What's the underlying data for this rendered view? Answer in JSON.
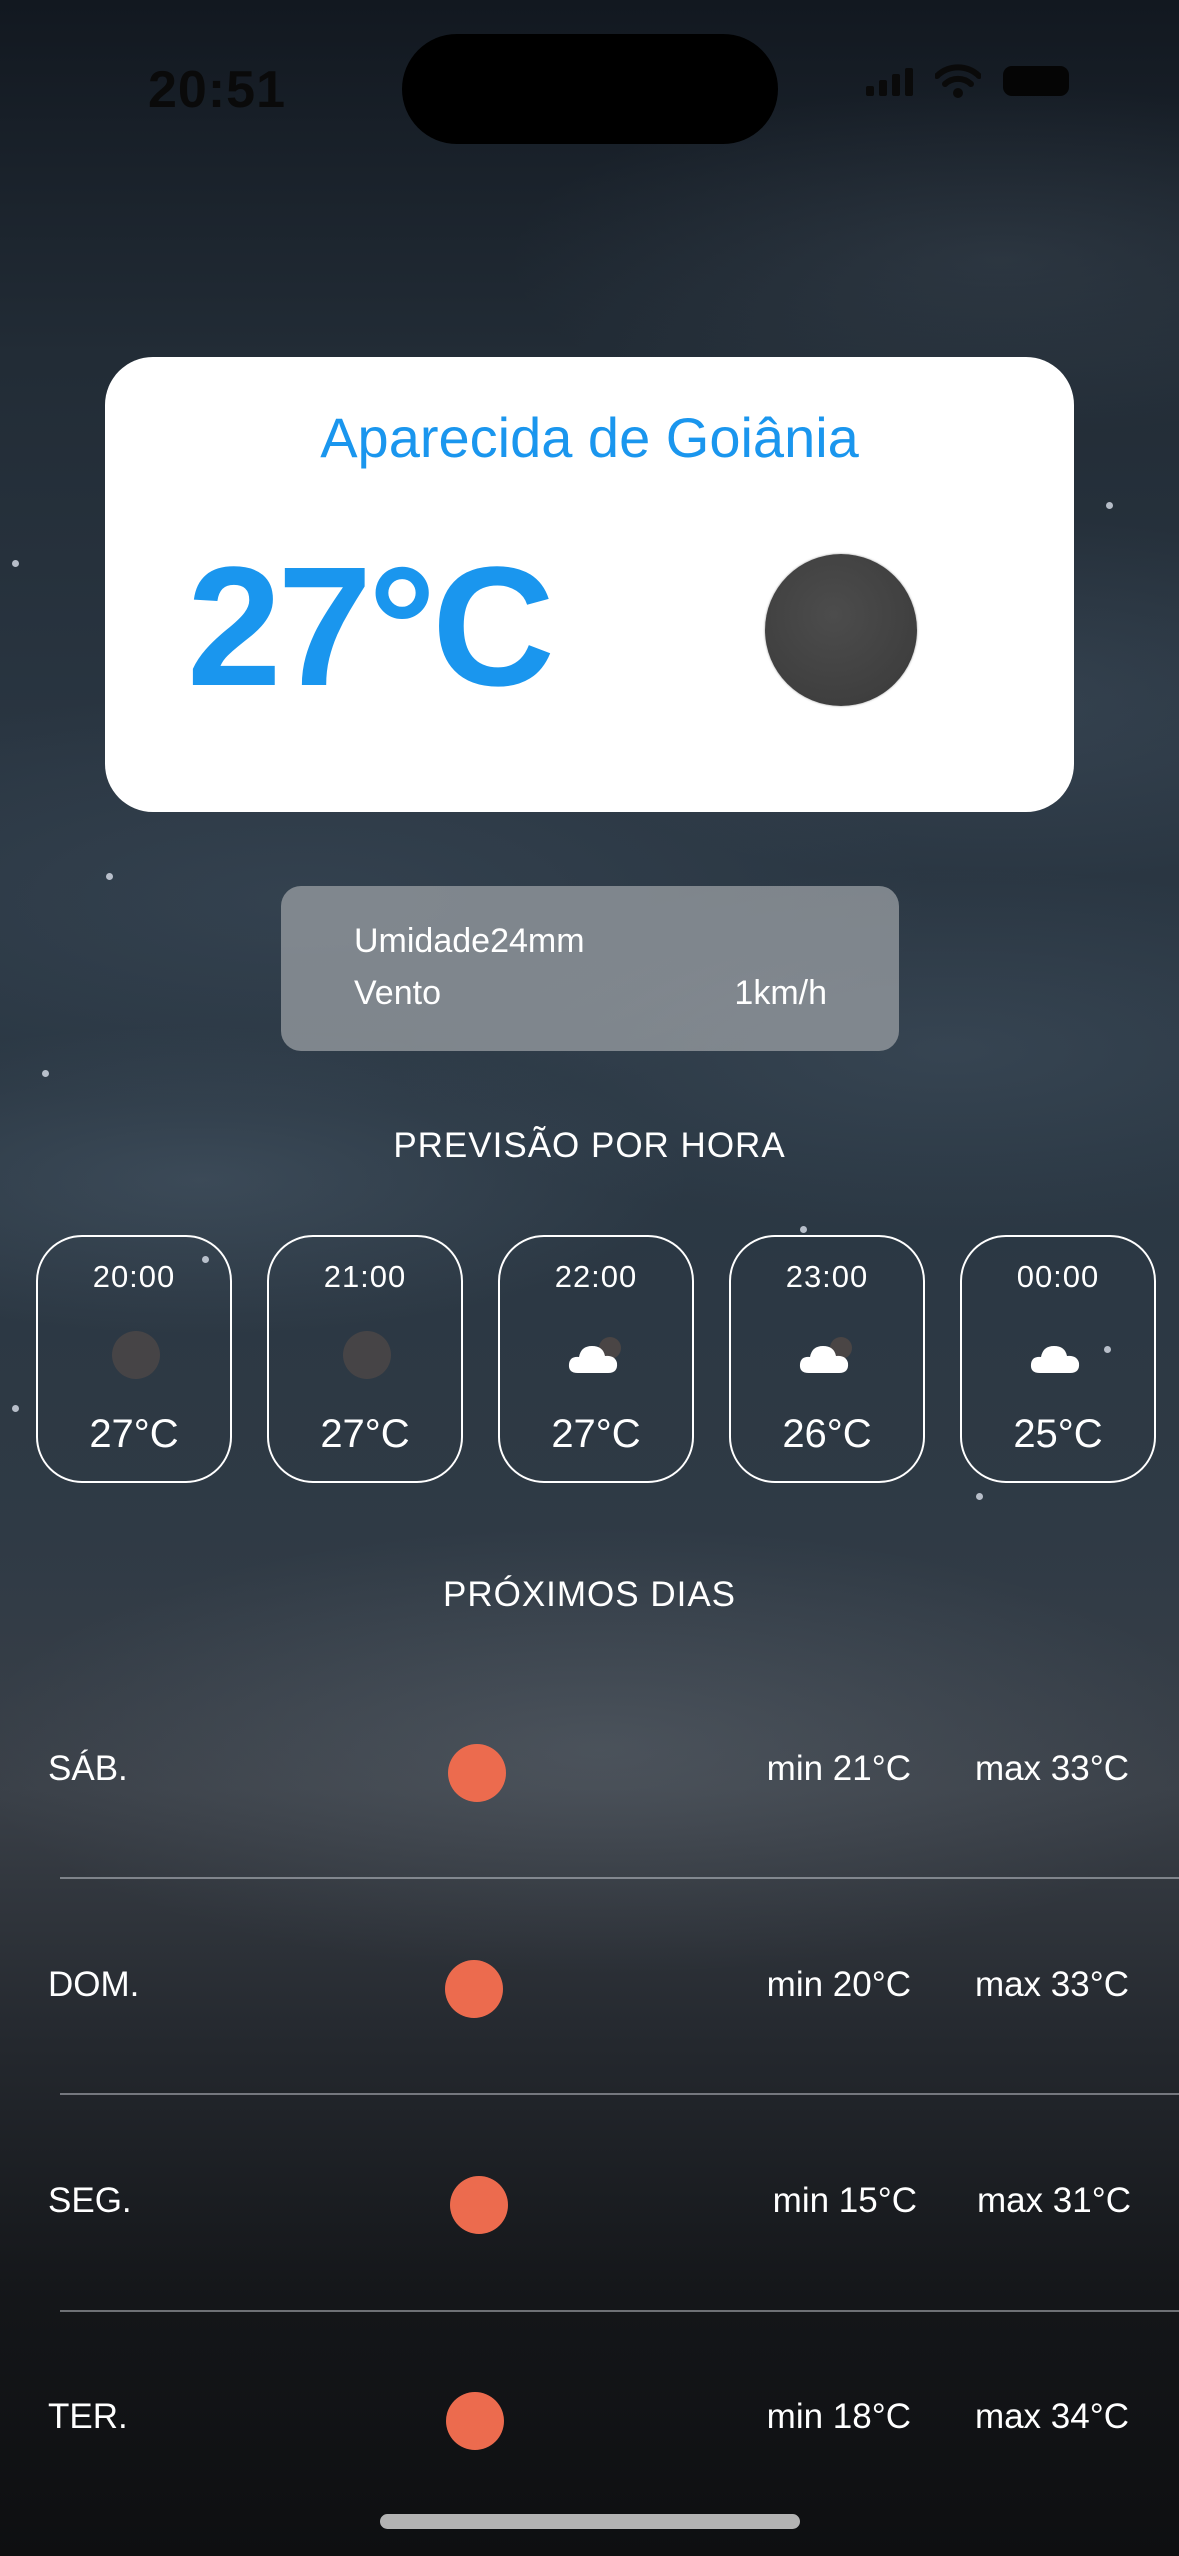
{
  "status_bar": {
    "time": "20:51"
  },
  "current": {
    "city": "Aparecida de Goiânia",
    "temperature": "27°C",
    "icon": "moon-icon"
  },
  "details": {
    "humidity_label_value": "Umidade24mm",
    "wind_label": "Vento",
    "wind_value": "1km/h"
  },
  "hourly": {
    "title": "PREVISÃO POR HORA",
    "items": [
      {
        "time": "20:00",
        "temp": "27°C",
        "icon": "moon-icon"
      },
      {
        "time": "21:00",
        "temp": "27°C",
        "icon": "moon-icon"
      },
      {
        "time": "22:00",
        "temp": "27°C",
        "icon": "cloud-moon-icon"
      },
      {
        "time": "23:00",
        "temp": "26°C",
        "icon": "cloud-moon-icon"
      },
      {
        "time": "00:00",
        "temp": "25°C",
        "icon": "cloud-icon"
      }
    ]
  },
  "daily": {
    "title": "PRÓXIMOS DIAS",
    "items": [
      {
        "day": "SÁB.",
        "min": "min 21°C",
        "max": "max 33°C",
        "icon": "sun-icon"
      },
      {
        "day": "DOM.",
        "min": "min 20°C",
        "max": "max 33°C",
        "icon": "sun-icon"
      },
      {
        "day": "SEG.",
        "min": "min 15°C",
        "max": "max 31°C",
        "icon": "sun-icon"
      },
      {
        "day": "TER.",
        "min": "min 18°C",
        "max": "max 34°C",
        "icon": "sun-icon"
      }
    ]
  },
  "colors": {
    "accent": "#1a96ee",
    "sun": "#ec6b4e"
  }
}
